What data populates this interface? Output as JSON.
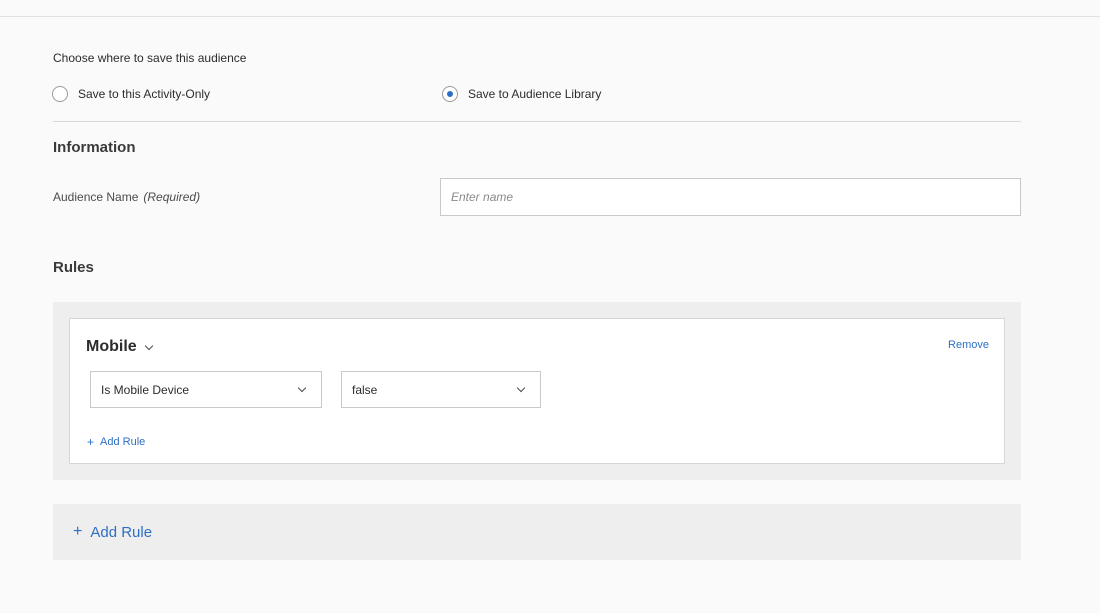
{
  "save_location": {
    "prompt": "Choose where to save this audience",
    "options": [
      {
        "label": "Save to this Activity-Only",
        "selected": false
      },
      {
        "label": "Save to Audience Library",
        "selected": true
      }
    ]
  },
  "information": {
    "heading": "Information",
    "audience_name_label": "Audience Name",
    "required_label": "(Required)",
    "audience_name_placeholder": "Enter name",
    "audience_name_value": ""
  },
  "rules": {
    "heading": "Rules",
    "card": {
      "title": "Mobile",
      "remove_label": "Remove",
      "attribute_selected": "Is Mobile Device",
      "value_selected": "false",
      "add_rule_label": "Add Rule"
    },
    "add_rule_label": "Add Rule"
  },
  "colors": {
    "accent": "#2d6fc6",
    "panel_bg": "#eeeeee",
    "page_bg": "#fafafa"
  }
}
